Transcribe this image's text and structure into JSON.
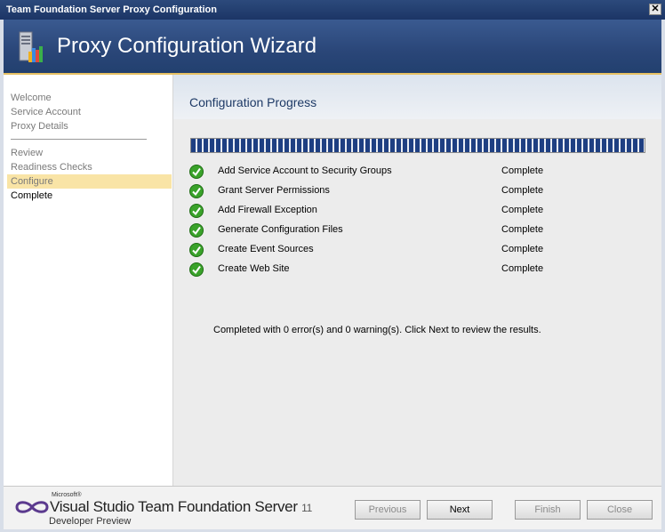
{
  "window": {
    "title": "Team Foundation Server Proxy Configuration",
    "close_glyph": "✕"
  },
  "banner": {
    "heading": "Proxy Configuration Wizard",
    "icon": "server-wizard-icon"
  },
  "nav": {
    "items": [
      {
        "label": "Welcome"
      },
      {
        "label": "Service Account"
      },
      {
        "label": "Proxy Details"
      },
      {
        "label": "Review"
      },
      {
        "label": "Readiness Checks"
      },
      {
        "label": "Configure"
      },
      {
        "label": "Complete"
      }
    ],
    "active_color": "#f9e4a6"
  },
  "content": {
    "heading": "Configuration Progress",
    "progress_fraction": 1.0,
    "tasks": [
      {
        "name": "Add Service Account to Security Groups",
        "status": "Complete"
      },
      {
        "name": "Grant Server Permissions",
        "status": "Complete"
      },
      {
        "name": "Add Firewall Exception",
        "status": "Complete"
      },
      {
        "name": "Generate Configuration Files",
        "status": "Complete"
      },
      {
        "name": "Create Event Sources",
        "status": "Complete"
      },
      {
        "name": "Create Web Site",
        "status": "Complete"
      }
    ],
    "summary": "Completed with 0 error(s) and 0 warning(s). Click Next to review the results."
  },
  "footer": {
    "logo": {
      "microsoft": "Microsoft®",
      "product": "Visual Studio Team Foundation Server",
      "version": "11",
      "edition": "Developer Preview"
    },
    "buttons": {
      "previous": "Previous",
      "next": "Next",
      "finish": "Finish",
      "close": "Close"
    }
  },
  "colors": {
    "accent_banner": "#2a4678",
    "progress_fill": "#1e3f82",
    "check_green": "#3aa22a"
  }
}
